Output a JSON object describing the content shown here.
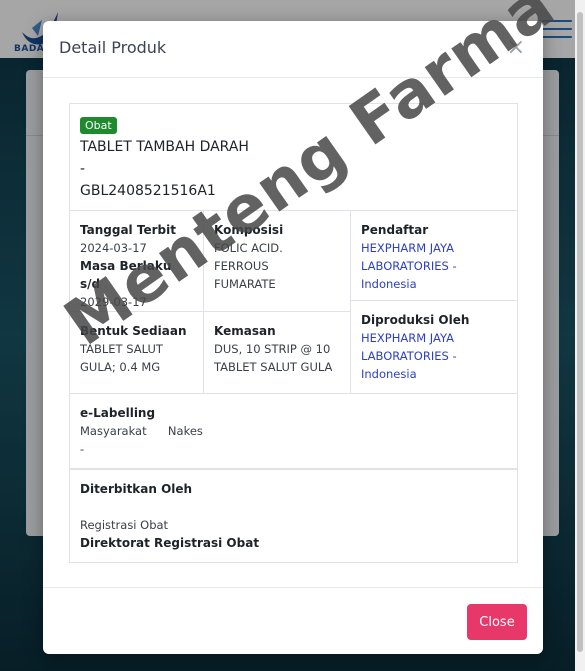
{
  "background": {
    "logo_text": "BADAN"
  },
  "modal": {
    "title": "Detail Produk",
    "close_symbol": "×",
    "close_button_label": "Close"
  },
  "product": {
    "badge": "Obat",
    "name": "TABLET TAMBAH DARAH",
    "separator": "-",
    "registration_number": "GBL2408521516A1",
    "tanggal_terbit_label": "Tanggal Terbit",
    "tanggal_terbit_value": "2024-03-17",
    "masa_berlaku_label": "Masa Berlaku s/d",
    "masa_berlaku_value": "2029-03-17",
    "komposisi_label": "Komposisi",
    "komposisi_value_1": "FOLIC ACID. FERROUS",
    "komposisi_value_2": "FUMARATE",
    "pendaftar_label": "Pendaftar",
    "pendaftar_value_1": "HEXPHARM JAYA",
    "pendaftar_value_2": "LABORATORIES -",
    "pendaftar_value_3": "Indonesia",
    "bentuk_label": "Bentuk Sediaan",
    "bentuk_value_1": "TABLET SALUT",
    "bentuk_value_2": "GULA; 0.4 MG",
    "kemasan_label": "Kemasan",
    "kemasan_value_1": "DUS, 10 STRIP @ 10",
    "kemasan_value_2": "TABLET SALUT GULA",
    "diproduksi_label": "Diproduksi Oleh",
    "diproduksi_value_1": "HEXPHARM JAYA",
    "diproduksi_value_2": "LABORATORIES -",
    "diproduksi_value_3": "Indonesia",
    "elabelling_label": "e-Labelling",
    "elabelling_masyarakat": "Masyarakat",
    "elabelling_nakes": "Nakes",
    "elabelling_dash": "-",
    "diterbitkan_label": "Diterbitkan Oleh",
    "diterbitkan_value_1": "Registrasi Obat",
    "diterbitkan_value_2": "Direktorat Registrasi Obat"
  },
  "watermark_text": "Menteng Farma"
}
